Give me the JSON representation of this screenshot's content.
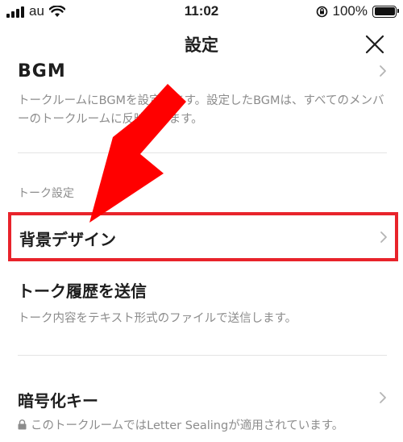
{
  "status_bar": {
    "carrier": "au",
    "time": "11:02",
    "battery_percent": "100%",
    "battery_level": 1.0
  },
  "header": {
    "title": "設定",
    "close_icon": "close-icon"
  },
  "bgm": {
    "title": "BGM",
    "description": "トークルームにBGMを設定します。設定したBGMは、すべてのメンバーのトークルームに反映されます。"
  },
  "talk_settings": {
    "section_label": "トーク設定",
    "background_design": "背景デザイン",
    "export_title": "トーク履歴を送信",
    "export_description": "トーク内容をテキスト形式のファイルで送信します。",
    "encryption_title": "暗号化キー",
    "encryption_description": "このトークルームではLetter Sealingが適用されています。"
  },
  "colors": {
    "highlight": "#e8232b",
    "arrow": "#ff0000",
    "subtext": "#8c8c8c"
  }
}
